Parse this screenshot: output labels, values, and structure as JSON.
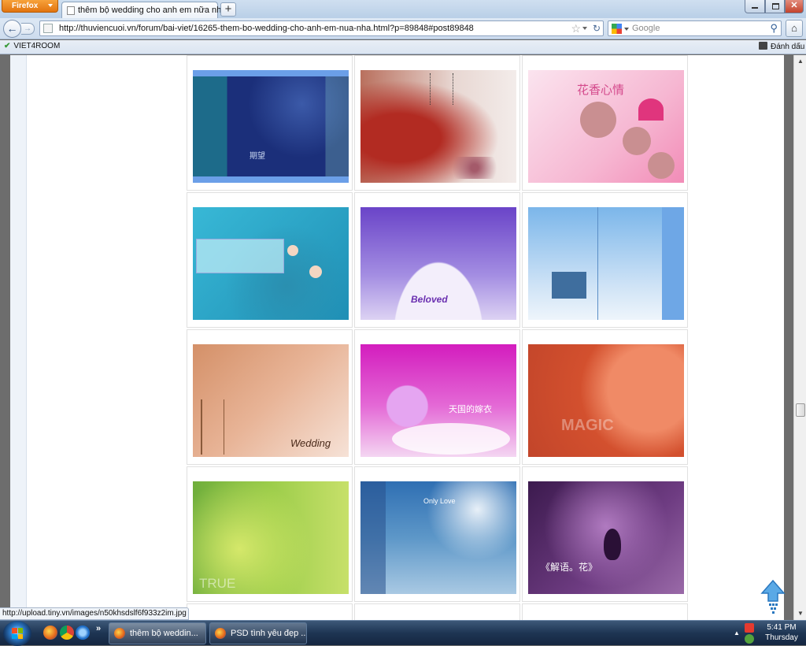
{
  "browser": {
    "menu_button": "Firefox",
    "tab_title": "thêm bộ wedding cho anh em nữa nha",
    "url": "http://thuviencuoi.vn/forum/bai-viet/16265-them-bo-wedding-cho-anh-em-nua-nha.html?p=89848#post89848",
    "search_placeholder": "Google",
    "bookmark_left": "VIET4ROOM",
    "bookmark_right": "Đánh dấu",
    "status_url": "http://upload.tiny.vn/images/n50khsdslf6f933z2im.jpg"
  },
  "gallery": {
    "thumbnails": [
      {
        "id": "t1",
        "text": "期望"
      },
      {
        "id": "t2",
        "text": ""
      },
      {
        "id": "t3",
        "text": "花香心情"
      },
      {
        "id": "t4",
        "text": ""
      },
      {
        "id": "t5",
        "text": "Beloved"
      },
      {
        "id": "t6",
        "text": ""
      },
      {
        "id": "t7",
        "text": "Wedding"
      },
      {
        "id": "t8",
        "text": "天国的嫁衣"
      },
      {
        "id": "t9",
        "text": "MAGIC"
      },
      {
        "id": "t10",
        "text": "TRUE"
      },
      {
        "id": "t11",
        "text": "Only Love"
      },
      {
        "id": "t12",
        "text": "《解语。花》"
      }
    ]
  },
  "taskbar": {
    "buttons": [
      {
        "label": "thêm bộ weddin..."
      },
      {
        "label": "PSD tình yêu đẹp ..."
      }
    ],
    "time": "5:41 PM",
    "day": "Thursday"
  },
  "colors": {
    "taskbar": "#1e3553",
    "titlebar": "#c4d6eb",
    "firefox_orange": "#e57912"
  }
}
